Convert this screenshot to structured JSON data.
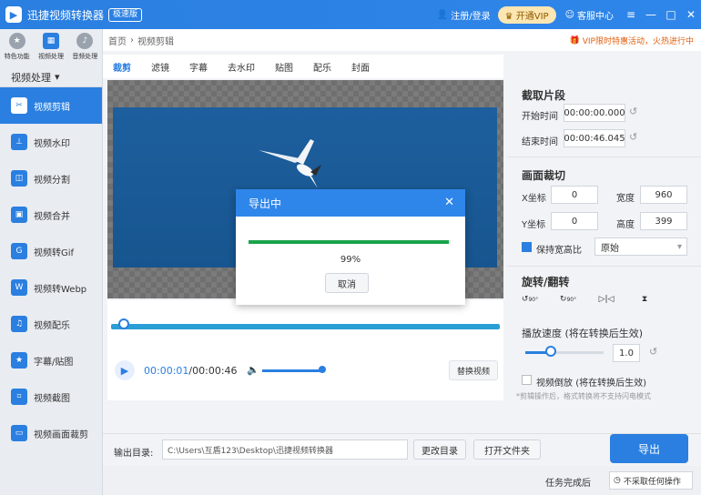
{
  "app": {
    "title": "迅捷视频转换器",
    "edition": "极速版",
    "login": "注册/登录",
    "vip": "开通VIP",
    "service": "客服中心"
  },
  "sidebar": {
    "modes": [
      {
        "label": "特色功能"
      },
      {
        "label": "视频处理"
      },
      {
        "label": "音频处理"
      }
    ],
    "category": "视频处理",
    "items": [
      {
        "label": "视频剪辑",
        "active": true
      },
      {
        "label": "视频水印"
      },
      {
        "label": "视频分割"
      },
      {
        "label": "视频合并"
      },
      {
        "label": "视频转Gif"
      },
      {
        "label": "视频转Webp"
      },
      {
        "label": "视频配乐"
      },
      {
        "label": "字幕/贴图"
      },
      {
        "label": "视频截图"
      },
      {
        "label": "视频画面裁剪"
      }
    ]
  },
  "breadcrumb": {
    "home": "首页",
    "current": "视频剪辑"
  },
  "promo": "VIP限时特惠活动，火热进行中",
  "tabs": [
    "裁剪",
    "滤镜",
    "字幕",
    "去水印",
    "贴图",
    "配乐",
    "封面"
  ],
  "player": {
    "current": "00:00:01",
    "separator": "/",
    "total": "00:00:46",
    "replace": "替换视频",
    "volume": 0.9,
    "position": 0.03
  },
  "clip": {
    "title": "截取片段",
    "start_label": "开始时间",
    "start": "00:00:00.000",
    "end_label": "结束时间",
    "end": "00:00:46.045"
  },
  "crop": {
    "title": "画面裁切",
    "x_label": "X坐标",
    "x": "0",
    "w_label": "宽度",
    "w": "960",
    "y_label": "Y坐标",
    "y": "0",
    "h_label": "高度",
    "h": "399",
    "keep_ratio": "保持宽高比",
    "ratio": "原始"
  },
  "rotate": {
    "title": "旋转/翻转",
    "ccw": "90°",
    "cw": "90°"
  },
  "speed": {
    "title": "播放速度",
    "note": "(将在转换后生效)",
    "value": "1.0",
    "level": 0.3
  },
  "reverse": {
    "label": "视频倒放",
    "note": "(将在转换后生效)",
    "hint": "*剪辑操作后，格式转换将不支持闪电模式"
  },
  "output": {
    "label": "输出目录:",
    "path": "C:\\Users\\互盾123\\Desktop\\迅捷视频转换器",
    "change": "更改目录",
    "open": "打开文件夹",
    "export": "导出"
  },
  "status": {
    "done_label": "任务完成后",
    "done_value": "不采取任何操作"
  },
  "dialog": {
    "title": "导出中",
    "percent": "99%",
    "progress": 0.99,
    "cancel": "取消"
  },
  "colors": {
    "accent": "#2a7fe0",
    "progress": "#1aa34a"
  }
}
